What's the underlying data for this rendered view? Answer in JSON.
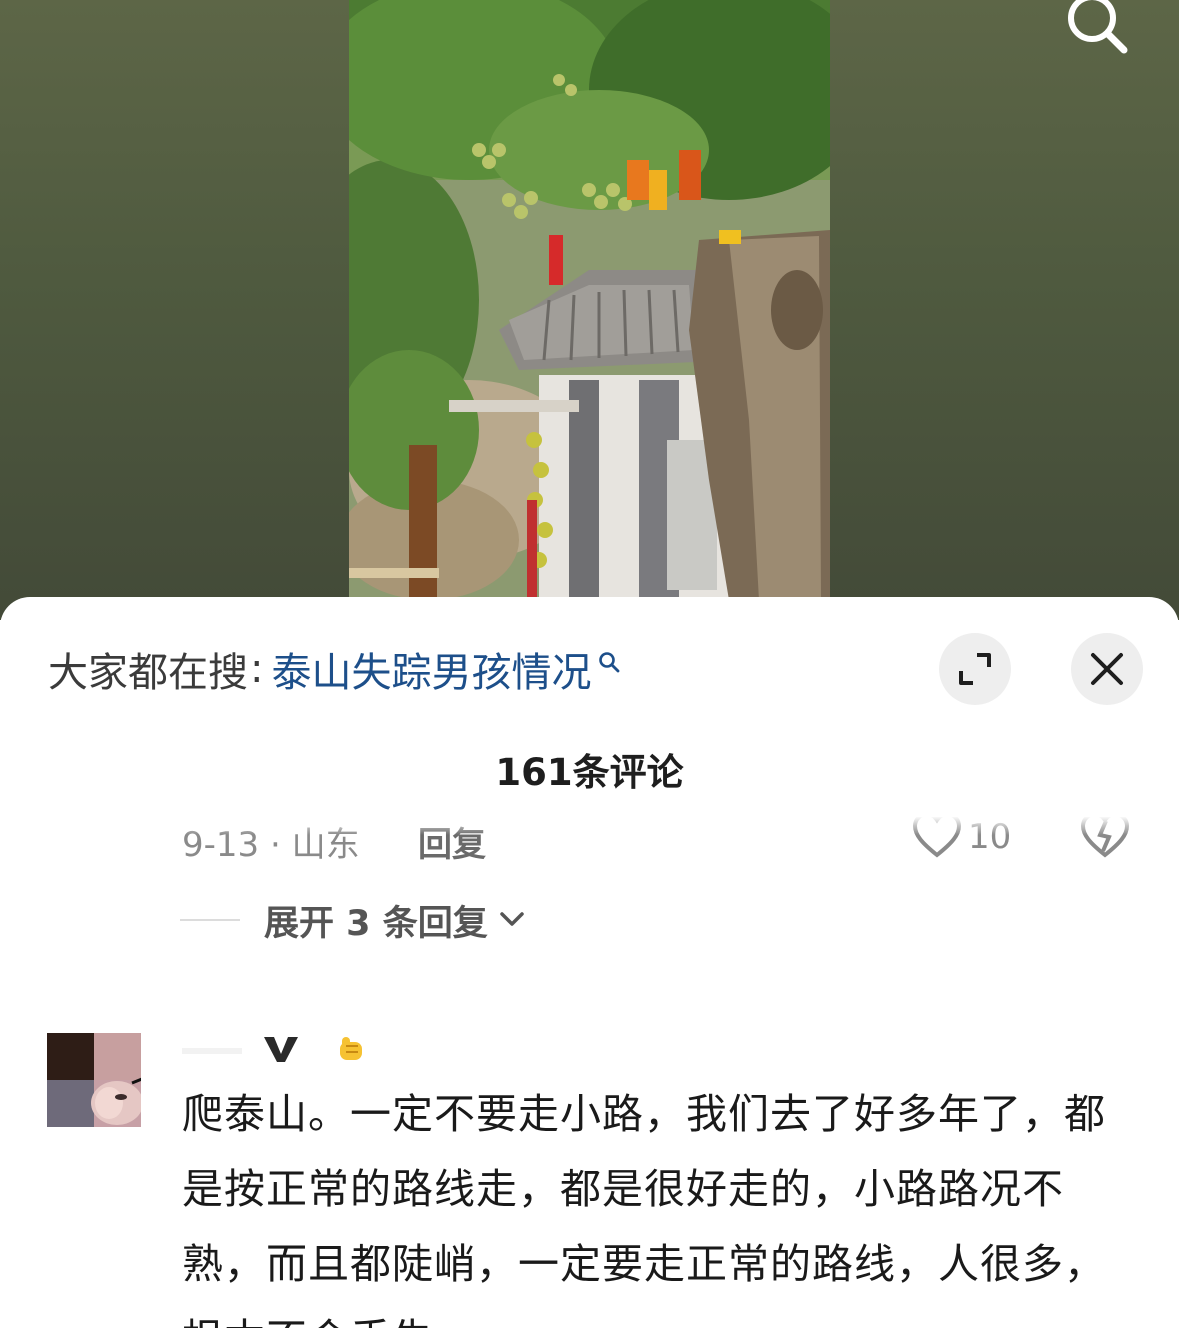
{
  "hot_search": {
    "prefix": "大家都在搜",
    "separator": ":",
    "term": "泰山失踪男孩情况"
  },
  "comments_header": {
    "count_label": "161条评论"
  },
  "previous_comment": {
    "date_location": "9-13 · 山东",
    "reply_label": "回复",
    "like_count": "10"
  },
  "expand_replies": {
    "label": "展开 3 条回复"
  },
  "comment": {
    "text": "爬泰山。一定不要走小路，我们去了好多年了，都是按正常的路线走，都是很好走的，小路路况不熟，而且都陡峭，一定要走正常的路线，人很多，根本不会丢失"
  },
  "colors": {
    "link_blue": "#1d4f8a",
    "video_bg": "#4f5a3f"
  },
  "icons": [
    "search-icon",
    "expand-icon",
    "close-icon",
    "heart-icon",
    "dislike-icon",
    "chevron-down-icon",
    "verified-icon",
    "fist-emoji-icon"
  ]
}
